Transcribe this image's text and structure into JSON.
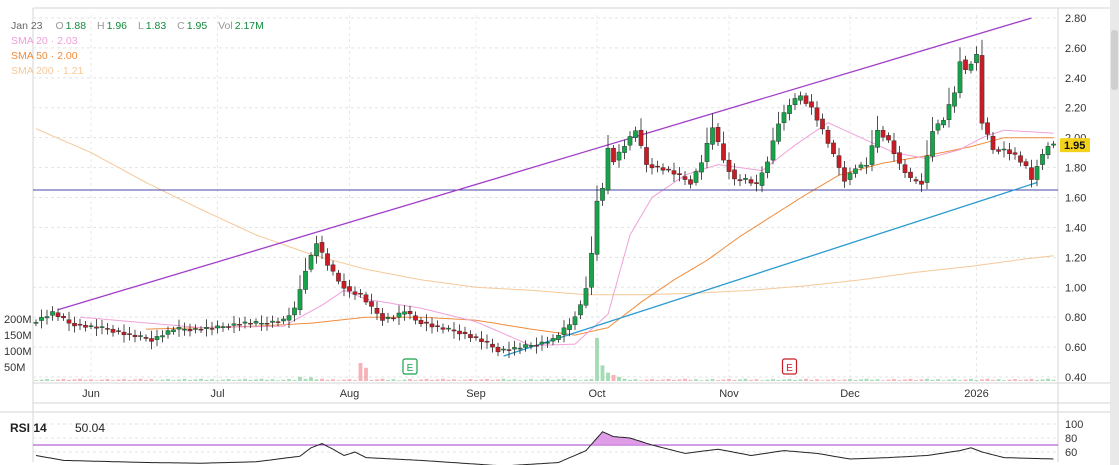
{
  "legend": {
    "date": "Jan 23",
    "open_label": "O",
    "open": "1.88",
    "high_label": "H",
    "high": "1.96",
    "low_label": "L",
    "low": "1.83",
    "close_label": "C",
    "close": "1.95",
    "vol_label": "Vol",
    "vol": "2.17M",
    "sma20": "SMA 20 · 2.03",
    "sma50": "SMA 50 · 2.00",
    "sma200": "SMA 200 · 1.21"
  },
  "rsi": {
    "label": "RSI 14",
    "value": "50.04"
  },
  "colors": {
    "up": "#17a34a",
    "down": "#c81d25",
    "sma20": "#f0a0d8",
    "sma50": "#f08c3c",
    "sma200": "#f5c89a",
    "channel": "#a23ec8",
    "support_line": "#2a9bd0",
    "horizontal_line": "#4a4aa8",
    "price_badge": "#f2d21b",
    "rsi_fill": "#d98ce3"
  },
  "chart_data": {
    "type": "candlestick",
    "y_ticks": [
      "2.80",
      "2.60",
      "2.40",
      "2.20",
      "2.00",
      "1.80",
      "1.60",
      "1.40",
      "1.20",
      "1.00",
      "0.80",
      "0.60",
      "0.40"
    ],
    "ylim": [
      0.36,
      2.82
    ],
    "x_labels": [
      {
        "label": "Jun",
        "t": 10
      },
      {
        "label": "Jul",
        "t": 33
      },
      {
        "label": "Aug",
        "t": 57
      },
      {
        "label": "Sep",
        "t": 80
      },
      {
        "label": "Oct",
        "t": 102
      },
      {
        "label": "Nov",
        "t": 126
      },
      {
        "label": "Dec",
        "t": 148
      },
      {
        "label": "2026",
        "t": 171
      }
    ],
    "n_bars": 186,
    "volume_ticks": [
      "200M",
      "150M",
      "100M",
      "50M"
    ],
    "current_price_badge": "1.95",
    "earnings_markers": [
      {
        "label": "E",
        "t": 68,
        "color": "#17a34a"
      },
      {
        "label": "E",
        "t": 137,
        "color": "#c81d25"
      }
    ],
    "horizontal_line": 1.65,
    "channel_upper": [
      [
        4,
        0.85
      ],
      [
        181,
        2.8
      ]
    ],
    "support_line": [
      [
        85,
        0.54
      ],
      [
        182,
        1.7
      ]
    ],
    "price_keys": [
      [
        0,
        0.76
      ],
      [
        4,
        0.83
      ],
      [
        7,
        0.76
      ],
      [
        10,
        0.74
      ],
      [
        14,
        0.72
      ],
      [
        18,
        0.68
      ],
      [
        22,
        0.65
      ],
      [
        26,
        0.72
      ],
      [
        30,
        0.72
      ],
      [
        34,
        0.73
      ],
      [
        38,
        0.76
      ],
      [
        42,
        0.76
      ],
      [
        46,
        0.78
      ],
      [
        48,
        0.85
      ],
      [
        50,
        1.12
      ],
      [
        52,
        1.3
      ],
      [
        54,
        1.15
      ],
      [
        56,
        1.04
      ],
      [
        58,
        0.97
      ],
      [
        60,
        0.95
      ],
      [
        62,
        0.86
      ],
      [
        64,
        0.79
      ],
      [
        66,
        0.8
      ],
      [
        68,
        0.84
      ],
      [
        70,
        0.78
      ],
      [
        74,
        0.73
      ],
      [
        78,
        0.7
      ],
      [
        82,
        0.64
      ],
      [
        85,
        0.58
      ],
      [
        88,
        0.59
      ],
      [
        92,
        0.62
      ],
      [
        95,
        0.65
      ],
      [
        98,
        0.75
      ],
      [
        100,
        0.88
      ],
      [
        101,
        1.0
      ],
      [
        102,
        1.22
      ],
      [
        103,
        1.58
      ],
      [
        104,
        1.65
      ],
      [
        105,
        1.93
      ],
      [
        106,
        1.85
      ],
      [
        108,
        1.95
      ],
      [
        110,
        2.05
      ],
      [
        112,
        1.82
      ],
      [
        116,
        1.78
      ],
      [
        120,
        1.7
      ],
      [
        122,
        1.84
      ],
      [
        124,
        2.07
      ],
      [
        126,
        1.85
      ],
      [
        128,
        1.72
      ],
      [
        130,
        1.72
      ],
      [
        132,
        1.68
      ],
      [
        134,
        1.85
      ],
      [
        136,
        2.1
      ],
      [
        138,
        2.22
      ],
      [
        140,
        2.28
      ],
      [
        142,
        2.2
      ],
      [
        144,
        2.05
      ],
      [
        146,
        1.88
      ],
      [
        148,
        1.72
      ],
      [
        150,
        1.8
      ],
      [
        152,
        1.82
      ],
      [
        154,
        2.05
      ],
      [
        156,
        1.98
      ],
      [
        158,
        1.82
      ],
      [
        160,
        1.72
      ],
      [
        162,
        1.7
      ],
      [
        164,
        2.05
      ],
      [
        166,
        2.12
      ],
      [
        168,
        2.3
      ],
      [
        169,
        2.52
      ],
      [
        170,
        2.45
      ],
      [
        172,
        2.55
      ],
      [
        173,
        2.1
      ],
      [
        175,
        1.92
      ],
      [
        177,
        1.92
      ],
      [
        179,
        1.88
      ],
      [
        181,
        1.8
      ],
      [
        182,
        1.72
      ],
      [
        183,
        1.82
      ],
      [
        185,
        1.95
      ]
    ],
    "sma20_keys": [
      [
        8,
        0.8
      ],
      [
        30,
        0.73
      ],
      [
        45,
        0.74
      ],
      [
        52,
        0.88
      ],
      [
        56,
        0.98
      ],
      [
        60,
        0.92
      ],
      [
        70,
        0.86
      ],
      [
        80,
        0.77
      ],
      [
        90,
        0.61
      ],
      [
        98,
        0.62
      ],
      [
        104,
        0.82
      ],
      [
        108,
        1.35
      ],
      [
        112,
        1.6
      ],
      [
        118,
        1.75
      ],
      [
        124,
        1.82
      ],
      [
        132,
        1.78
      ],
      [
        138,
        1.95
      ],
      [
        144,
        2.1
      ],
      [
        150,
        2.0
      ],
      [
        156,
        1.9
      ],
      [
        162,
        1.86
      ],
      [
        168,
        1.92
      ],
      [
        172,
        2.0
      ],
      [
        176,
        2.05
      ],
      [
        185,
        2.03
      ]
    ],
    "sma50_keys": [
      [
        20,
        0.72
      ],
      [
        40,
        0.74
      ],
      [
        50,
        0.76
      ],
      [
        60,
        0.8
      ],
      [
        70,
        0.8
      ],
      [
        80,
        0.78
      ],
      [
        90,
        0.72
      ],
      [
        98,
        0.68
      ],
      [
        104,
        0.73
      ],
      [
        110,
        0.9
      ],
      [
        116,
        1.05
      ],
      [
        122,
        1.18
      ],
      [
        128,
        1.34
      ],
      [
        134,
        1.48
      ],
      [
        140,
        1.62
      ],
      [
        146,
        1.75
      ],
      [
        154,
        1.83
      ],
      [
        162,
        1.88
      ],
      [
        170,
        1.94
      ],
      [
        176,
        2.0
      ],
      [
        185,
        2.0
      ]
    ],
    "sma200_keys": [
      [
        0,
        2.06
      ],
      [
        10,
        1.9
      ],
      [
        20,
        1.7
      ],
      [
        30,
        1.52
      ],
      [
        40,
        1.35
      ],
      [
        50,
        1.22
      ],
      [
        60,
        1.12
      ],
      [
        70,
        1.05
      ],
      [
        80,
        1.0
      ],
      [
        90,
        0.98
      ],
      [
        100,
        0.95
      ],
      [
        110,
        0.95
      ],
      [
        120,
        0.96
      ],
      [
        130,
        0.98
      ],
      [
        140,
        1.01
      ],
      [
        150,
        1.05
      ],
      [
        160,
        1.1
      ],
      [
        170,
        1.14
      ],
      [
        180,
        1.19
      ],
      [
        185,
        1.21
      ]
    ],
    "volume_spikes": [
      [
        59,
        0.3
      ],
      [
        60,
        0.22
      ],
      [
        102,
        0.72
      ],
      [
        103,
        0.26
      ],
      [
        104,
        0.14
      ],
      [
        105,
        0.1
      ],
      [
        106,
        0.07
      ],
      [
        48,
        0.07
      ],
      [
        50,
        0.06
      ]
    ],
    "rsi_ticks": [
      "100",
      "80",
      "60"
    ],
    "rsi_keys": [
      [
        0,
        55
      ],
      [
        5,
        48
      ],
      [
        10,
        47
      ],
      [
        20,
        45
      ],
      [
        30,
        44
      ],
      [
        40,
        46
      ],
      [
        48,
        54
      ],
      [
        50,
        66
      ],
      [
        52,
        72
      ],
      [
        54,
        64
      ],
      [
        56,
        55
      ],
      [
        58,
        60
      ],
      [
        60,
        52
      ],
      [
        70,
        48
      ],
      [
        85,
        40
      ],
      [
        95,
        45
      ],
      [
        100,
        62
      ],
      [
        102,
        80
      ],
      [
        103,
        89
      ],
      [
        105,
        82
      ],
      [
        108,
        80
      ],
      [
        112,
        70
      ],
      [
        118,
        58
      ],
      [
        124,
        64
      ],
      [
        130,
        55
      ],
      [
        136,
        62
      ],
      [
        142,
        58
      ],
      [
        148,
        50
      ],
      [
        155,
        52
      ],
      [
        162,
        55
      ],
      [
        168,
        62
      ],
      [
        170,
        66
      ],
      [
        172,
        60
      ],
      [
        176,
        52
      ],
      [
        185,
        50
      ]
    ]
  }
}
